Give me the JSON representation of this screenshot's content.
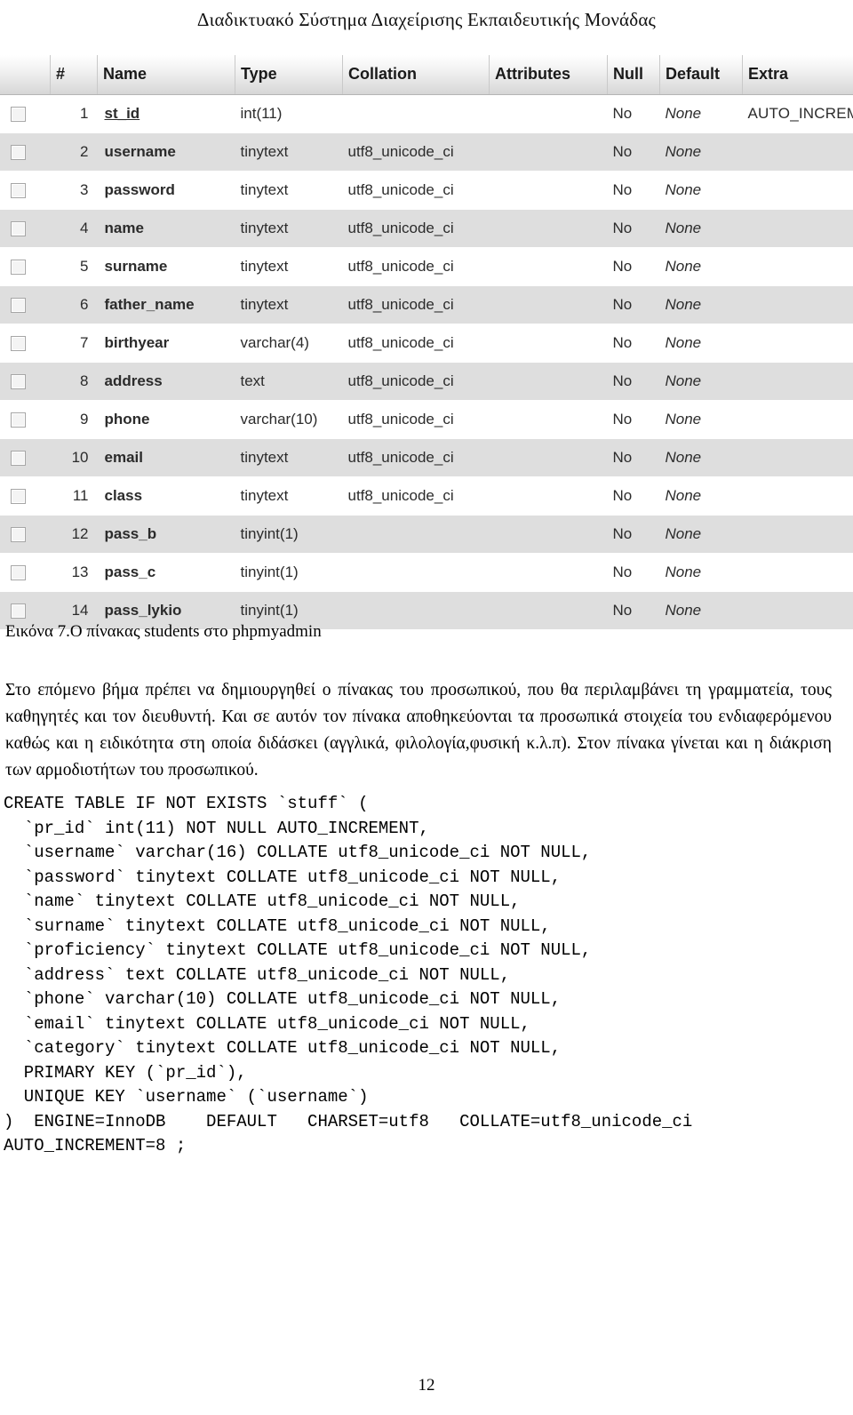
{
  "document": {
    "running_header": "Διαδικτυακό Σύστημα Διαχείρισης Εκπαιδευτικής Μονάδας",
    "page_number": "12"
  },
  "figure": {
    "caption": "Εικόνα 7.Ο πίνακας students στο phpmyadmin",
    "table": {
      "columns": [
        "#",
        "Name",
        "Type",
        "Collation",
        "Attributes",
        "Null",
        "Default",
        "Extra"
      ],
      "rows": [
        {
          "num": "1",
          "name": "st_id",
          "type": "int(11)",
          "collation": "",
          "attributes": "",
          "null": "No",
          "default": "None",
          "extra": "AUTO_INCREMENT",
          "primary_key": true
        },
        {
          "num": "2",
          "name": "username",
          "type": "tinytext",
          "collation": "utf8_unicode_ci",
          "attributes": "",
          "null": "No",
          "default": "None",
          "extra": "",
          "primary_key": false
        },
        {
          "num": "3",
          "name": "password",
          "type": "tinytext",
          "collation": "utf8_unicode_ci",
          "attributes": "",
          "null": "No",
          "default": "None",
          "extra": "",
          "primary_key": false
        },
        {
          "num": "4",
          "name": "name",
          "type": "tinytext",
          "collation": "utf8_unicode_ci",
          "attributes": "",
          "null": "No",
          "default": "None",
          "extra": "",
          "primary_key": false
        },
        {
          "num": "5",
          "name": "surname",
          "type": "tinytext",
          "collation": "utf8_unicode_ci",
          "attributes": "",
          "null": "No",
          "default": "None",
          "extra": "",
          "primary_key": false
        },
        {
          "num": "6",
          "name": "father_name",
          "type": "tinytext",
          "collation": "utf8_unicode_ci",
          "attributes": "",
          "null": "No",
          "default": "None",
          "extra": "",
          "primary_key": false
        },
        {
          "num": "7",
          "name": "birthyear",
          "type": "varchar(4)",
          "collation": "utf8_unicode_ci",
          "attributes": "",
          "null": "No",
          "default": "None",
          "extra": "",
          "primary_key": false
        },
        {
          "num": "8",
          "name": "address",
          "type": "text",
          "collation": "utf8_unicode_ci",
          "attributes": "",
          "null": "No",
          "default": "None",
          "extra": "",
          "primary_key": false
        },
        {
          "num": "9",
          "name": "phone",
          "type": "varchar(10)",
          "collation": "utf8_unicode_ci",
          "attributes": "",
          "null": "No",
          "default": "None",
          "extra": "",
          "primary_key": false
        },
        {
          "num": "10",
          "name": "email",
          "type": "tinytext",
          "collation": "utf8_unicode_ci",
          "attributes": "",
          "null": "No",
          "default": "None",
          "extra": "",
          "primary_key": false
        },
        {
          "num": "11",
          "name": "class",
          "type": "tinytext",
          "collation": "utf8_unicode_ci",
          "attributes": "",
          "null": "No",
          "default": "None",
          "extra": "",
          "primary_key": false
        },
        {
          "num": "12",
          "name": "pass_b",
          "type": "tinyint(1)",
          "collation": "",
          "attributes": "",
          "null": "No",
          "default": "None",
          "extra": "",
          "primary_key": false
        },
        {
          "num": "13",
          "name": "pass_c",
          "type": "tinyint(1)",
          "collation": "",
          "attributes": "",
          "null": "No",
          "default": "None",
          "extra": "",
          "primary_key": false
        },
        {
          "num": "14",
          "name": "pass_lykio",
          "type": "tinyint(1)",
          "collation": "",
          "attributes": "",
          "null": "No",
          "default": "None",
          "extra": "",
          "primary_key": false
        }
      ]
    }
  },
  "body": {
    "paragraph": "Στο επόμενο βήμα πρέπει να δημιουργηθεί ο πίνακας του προσωπικού, που θα περιλαμβάνει τη γραμματεία, τους καθηγητές και τον διευθυντή. Και σε αυτόν τον πίνακα αποθηκεύονται τα προσωπικά στοιχεία του ενδιαφερόμενου καθώς και η ειδικότητα στη οποία διδάσκει (αγγλικά, φιλολογία,φυσική κ.λ.π). Στον πίνακα γίνεται και η διάκριση των αρμοδιοτήτων του προσωπικού."
  },
  "sql": {
    "code": "CREATE TABLE IF NOT EXISTS `stuff` (\n  `pr_id` int(11) NOT NULL AUTO_INCREMENT,\n  `username` varchar(16) COLLATE utf8_unicode_ci NOT NULL,\n  `password` tinytext COLLATE utf8_unicode_ci NOT NULL,\n  `name` tinytext COLLATE utf8_unicode_ci NOT NULL,\n  `surname` tinytext COLLATE utf8_unicode_ci NOT NULL,\n  `proficiency` tinytext COLLATE utf8_unicode_ci NOT NULL,\n  `address` text COLLATE utf8_unicode_ci NOT NULL,\n  `phone` varchar(10) COLLATE utf8_unicode_ci NOT NULL,\n  `email` tinytext COLLATE utf8_unicode_ci NOT NULL,\n  `category` tinytext COLLATE utf8_unicode_ci NOT NULL,\n  PRIMARY KEY (`pr_id`),\n  UNIQUE KEY `username` (`username`)\n)  ENGINE=InnoDB    DEFAULT   CHARSET=utf8   COLLATE=utf8_unicode_ci\nAUTO_INCREMENT=8 ;"
  }
}
